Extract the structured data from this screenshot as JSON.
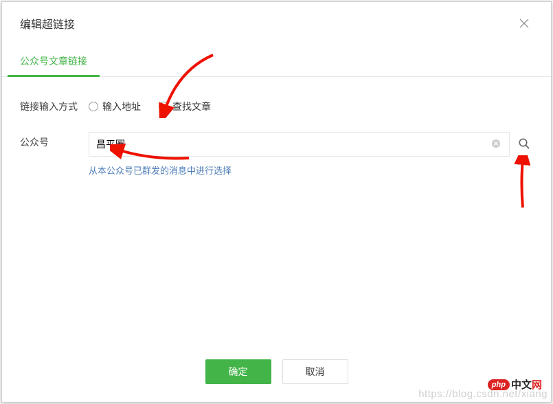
{
  "dialog": {
    "title": "编辑超链接",
    "tab": "公众号文章链接",
    "footer": {
      "ok": "确定",
      "cancel": "取消"
    }
  },
  "form": {
    "inputMethod": {
      "label": "链接输入方式",
      "options": {
        "url": "输入地址",
        "search": "查找文章"
      },
      "selected": "search"
    },
    "account": {
      "label": "公众号",
      "value": "昌平圈",
      "hint": "从本公众号已群发的消息中进行选择"
    }
  },
  "watermark": "https://blog.csdn.net/xiang",
  "badge": {
    "pill": "php",
    "text_prefix": "中文",
    "text_suffix": "网"
  }
}
